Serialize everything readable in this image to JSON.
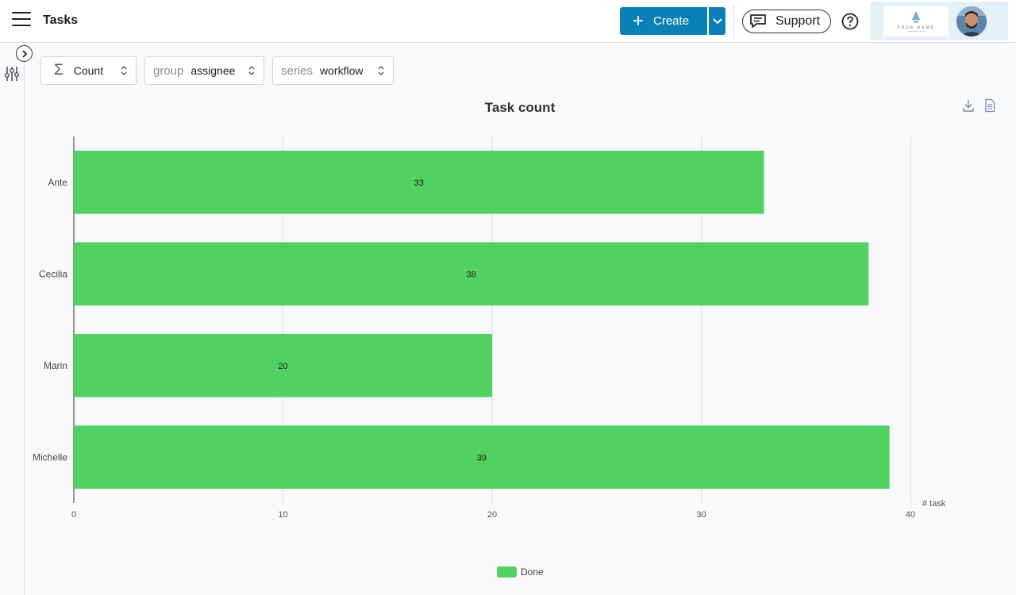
{
  "header": {
    "title": "Tasks",
    "create_label": "Create",
    "support_label": "Support",
    "logo_text": "YOUR NAME"
  },
  "controls": {
    "aggregate": {
      "value": "Count"
    },
    "group": {
      "prefix": "group",
      "value": "assignee"
    },
    "series": {
      "prefix": "series",
      "value": "workflow"
    }
  },
  "chart_data": {
    "type": "bar",
    "orientation": "horizontal",
    "title": "Task count",
    "xlabel": "# task",
    "ylabel": "",
    "categories": [
      "Ante",
      "Cecilia",
      "Marin",
      "Michelle"
    ],
    "series": [
      {
        "name": "Done",
        "color": "#52d163",
        "values": [
          33,
          38,
          20,
          39
        ]
      }
    ],
    "xlim": [
      0,
      40
    ],
    "xticks": [
      0,
      10,
      20,
      30,
      40
    ],
    "grid": true,
    "legend_position": "bottom"
  },
  "colors": {
    "brand": "#0a80b5",
    "bar": "#52d163"
  }
}
